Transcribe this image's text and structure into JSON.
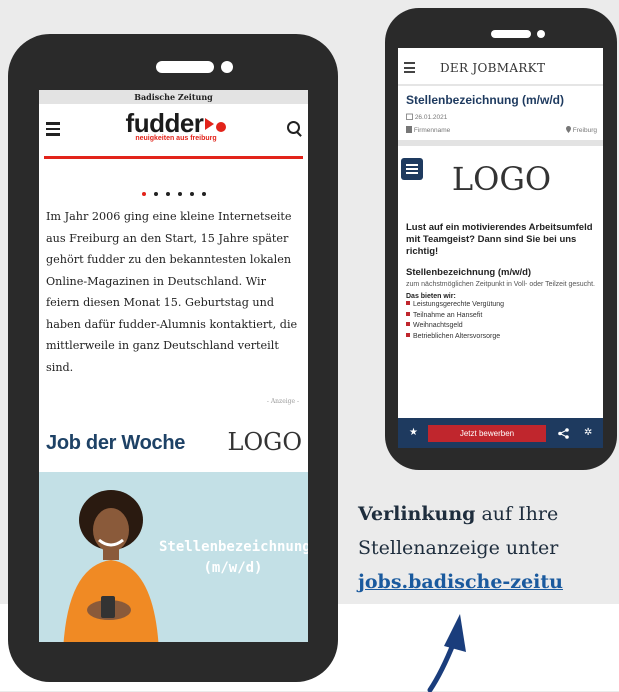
{
  "left_phone": {
    "newspaper_name": "Badische Zeitung",
    "logo_text": "fudder",
    "logo_tagline": "neuigkeiten aus freiburg",
    "article": "Im Jahr 2006 ging eine kleine Internetseite aus Freiburg an den Start, 15 Jahre später gehört fudder zu den bekanntesten lokalen Online-Magazinen in Deutschland. Wir feiern diesen Monat 15. Geburtstag und haben dafür fudder-Alumnis kontaktiert, die mittlerweile in ganz Deutschland verteilt sind.",
    "anzeige_label": "- Anzeige -",
    "job_der_woche": "Job der Woche",
    "job_logo": "LOGO",
    "image_text_line1": "Stellenbezeichnung",
    "image_text_line2": "(m/w/d)"
  },
  "right_phone": {
    "header_title": "DER JOBMARKT",
    "job_title": "Stellenbezeichnung (m/w/d)",
    "date": "26.01.2021",
    "company": "Firmenname",
    "location": "Freiburg",
    "logo": "LOGO",
    "lead_text": "Lust auf ein motivierendes Arbeitsumfeld mit Teamgeist? Dann sind Sie bei uns richtig!",
    "position_title": "Stellenbezeichnung (m/w/d)",
    "position_desc": "zum nächstmöglichen Zeitpunkt in Voll- oder Teilzeit gesucht.",
    "benefits_heading": "Das bieten wir:",
    "benefits": [
      "Leistungsgerechte Vergütung",
      "Teilnahme an Hansefit",
      "Weihnachtsgeld",
      "Betrieblichen Altersvorsorge"
    ],
    "apply_button": "Jetzt bewerben"
  },
  "caption": {
    "bold": "Verlinkung",
    "line1_rest": " auf Ihre",
    "line2": "Stellenanzeige unter",
    "link": "jobs.badische-zeitu"
  },
  "colors": {
    "accent_red": "#e2231a",
    "navy": "#1e3a5f",
    "button_red": "#c0262d",
    "phone_frame": "#2a2a2a",
    "link_blue": "#1a5a9e"
  }
}
